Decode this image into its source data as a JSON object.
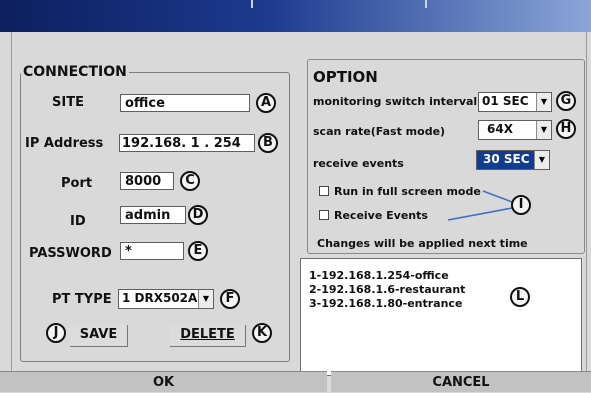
{
  "connection": {
    "legend": "CONNECTION",
    "site": {
      "label": "SITE",
      "value": "office",
      "marker": "A"
    },
    "ip": {
      "label": "IP Address",
      "value": "192.168.  1 . 254",
      "marker": "B"
    },
    "port": {
      "label": "Port",
      "value": "8000",
      "marker": "C"
    },
    "id": {
      "label": "ID",
      "value": "admin",
      "marker": "D"
    },
    "password": {
      "label": "PASSWORD",
      "value": "*",
      "marker": "E"
    },
    "pt_type": {
      "label": "PT TYPE",
      "value": "1 DRX502A",
      "marker": "F"
    },
    "save": {
      "label": "SAVE",
      "marker": "J"
    },
    "delete": {
      "label": "DELETE",
      "marker": "K"
    }
  },
  "option": {
    "title": "OPTION",
    "monitoring": {
      "label": "monitoring switch interval",
      "value": "01 SEC",
      "marker": "G"
    },
    "scan_rate": {
      "label": "scan rate(Fast mode)",
      "value": "64X",
      "marker": "H"
    },
    "receive_events": {
      "label": "receive events",
      "value": "30 SEC",
      "highlight": "#113c8f"
    },
    "full_screen": {
      "label": "Run in full screen mode",
      "checked": false
    },
    "receive_events_check": {
      "label": "Receive Events",
      "checked": false,
      "marker": "I"
    },
    "note": "Changes will be applied next time"
  },
  "site_list": {
    "items": [
      "1-192.168.1.254-office",
      "2-192.168.1.6-restaurant",
      "3-192.168.1.80-entrance"
    ],
    "marker": "L"
  },
  "footer": {
    "ok": "OK",
    "cancel": "CANCEL"
  }
}
